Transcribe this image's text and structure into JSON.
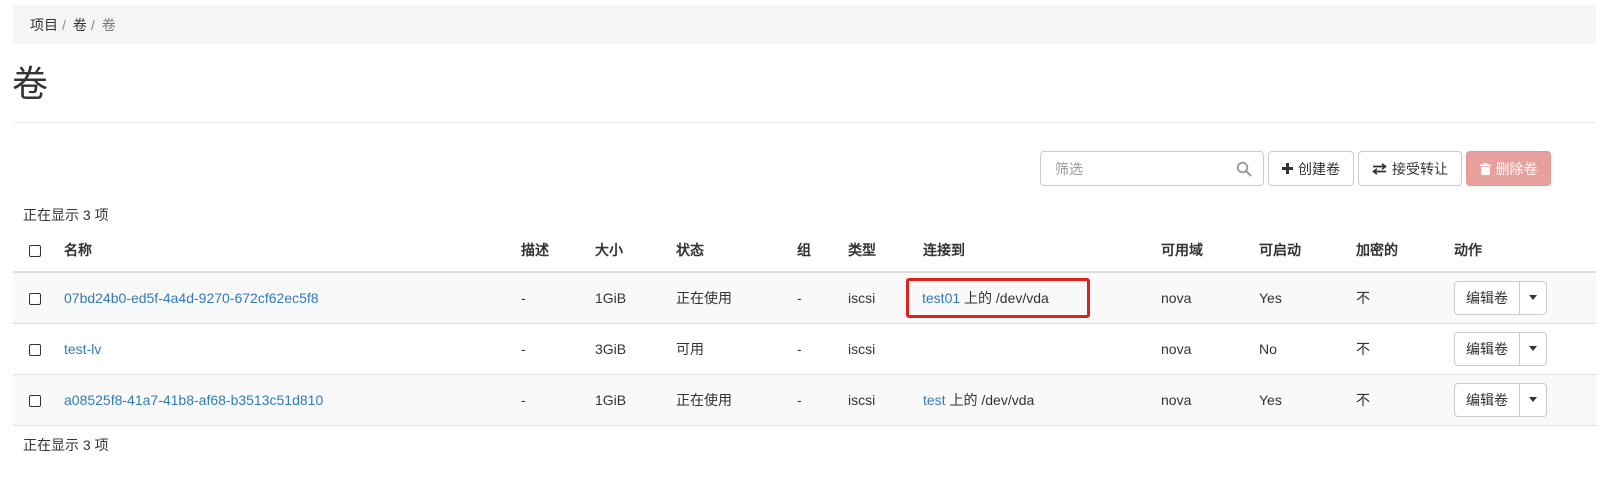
{
  "breadcrumb": {
    "items": [
      "项目",
      "卷",
      "卷"
    ]
  },
  "page": {
    "title": "卷"
  },
  "toolbar": {
    "filter_placeholder": "筛选",
    "create_label": "创建卷",
    "accept_transfer_label": "接受转让",
    "delete_label": "删除卷",
    "delete_color": "#e8a09d"
  },
  "table": {
    "showing_top": "正在显示 3 项",
    "showing_bottom": "正在显示 3 项",
    "columns": [
      "名称",
      "描述",
      "大小",
      "状态",
      "组",
      "类型",
      "连接到",
      "可用域",
      "可启动",
      "加密的",
      "动作"
    ],
    "rows": [
      {
        "name": "07bd24b0-ed5f-4a4d-9270-672cf62ec5f8",
        "description": "-",
        "size": "1GiB",
        "status": "正在使用",
        "group": "-",
        "type": "iscsi",
        "attached_instance": "test01",
        "attached_suffix": " 上的 /dev/vda",
        "zone": "nova",
        "bootable": "Yes",
        "encrypted": "不",
        "action": "编辑卷"
      },
      {
        "name": "test-lv",
        "description": "-",
        "size": "3GiB",
        "status": "可用",
        "group": "-",
        "type": "iscsi",
        "attached_instance": "",
        "attached_suffix": "",
        "zone": "nova",
        "bootable": "No",
        "encrypted": "不",
        "action": "编辑卷"
      },
      {
        "name": "a08525f8-41a7-41b8-af68-b3513c51d810",
        "description": "-",
        "size": "1GiB",
        "status": "正在使用",
        "group": "-",
        "type": "iscsi",
        "attached_instance": "test",
        "attached_suffix": " 上的 /dev/vda",
        "zone": "nova",
        "bootable": "Yes",
        "encrypted": "不",
        "action": "编辑卷"
      }
    ]
  },
  "colors": {
    "link": "#337ab7",
    "highlight_border": "#e0201b"
  }
}
